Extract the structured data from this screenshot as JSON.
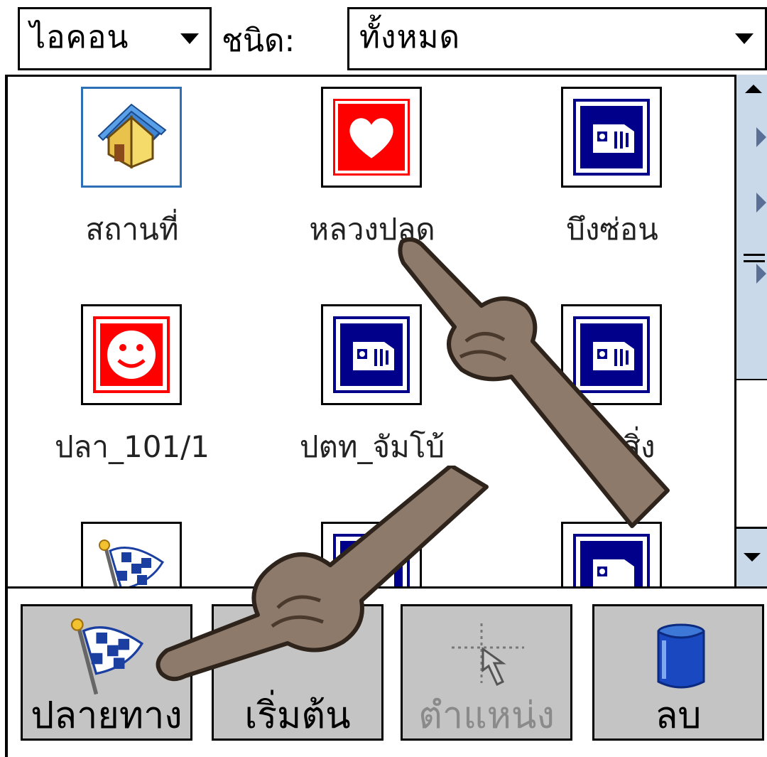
{
  "filter": {
    "view_value": "ไอคอน",
    "type_label": "ชนิด:",
    "type_value": "ทั้งหมด"
  },
  "items": [
    {
      "label": "สถานที่",
      "icon": "house-icon",
      "selected": true
    },
    {
      "label": "หลวงปลด",
      "icon": "heart-icon"
    },
    {
      "label": "บึงซ่อน",
      "icon": "camera-icon"
    },
    {
      "label": "ปลา_101/1",
      "icon": "smiley-icon"
    },
    {
      "label": "ปตท_จัมโบ้",
      "icon": "camera-icon"
    },
    {
      "label": "ร้านสิ่ง",
      "icon": "camera-icon"
    },
    {
      "label": "",
      "icon": "checkered-flag-icon"
    },
    {
      "label": "",
      "icon": "camera-icon"
    },
    {
      "label": "",
      "icon": "camera-icon"
    }
  ],
  "toolbar": {
    "destination": "ปลายทาง",
    "start": "เริ่มต้น",
    "position": "ตำแหน่ง",
    "delete": "ลบ"
  },
  "colors": {
    "selection": "#2d6fb5",
    "heart_red": "#ff0000",
    "camera_blue": "#00008b",
    "scroll_blue": "#c9d9ea",
    "button_gray": "#c4c4c4",
    "disabled_text": "#8a8a8a"
  }
}
